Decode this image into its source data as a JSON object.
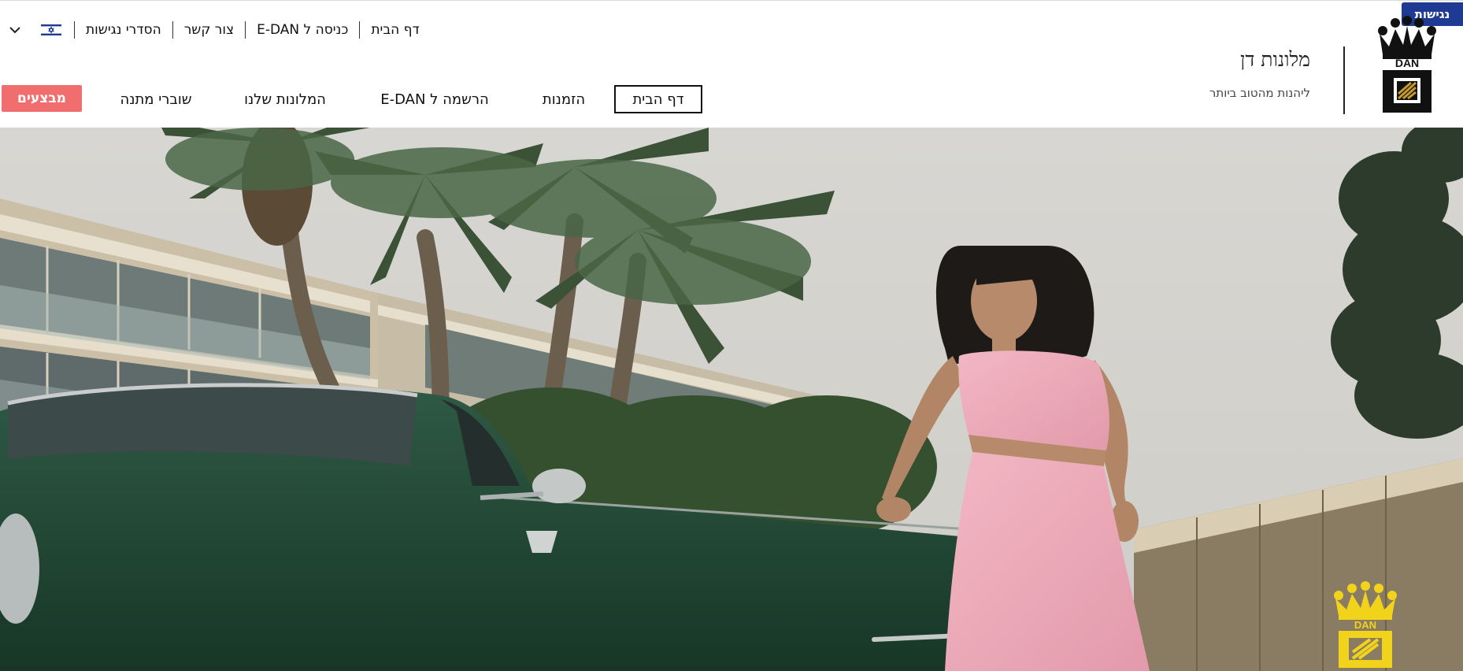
{
  "accessibility_tab": {
    "label": "נגישות"
  },
  "brand": {
    "title": "מלונות דן",
    "tagline": "ליהנות מהטוב ביותר",
    "logo_text": "DAN"
  },
  "utility_links": {
    "home": "דף הבית",
    "edan_login": "כניסה ל E-DAN",
    "contact": "צור קשר",
    "accessibility": "הסדרי נגישות"
  },
  "language": {
    "selected_icon": "israel-flag-icon",
    "dropdown_icon": "chevron-down-icon"
  },
  "main_nav": {
    "home": "דף הבית",
    "bookings": "הזמנות",
    "edan_register": "הרשמה ל E-DAN",
    "our_hotels": "המלונות שלנו",
    "gift_vouchers": "שוברי מתנה",
    "deals": "מבצעים"
  },
  "colors": {
    "accent_blue": "#1f3a93",
    "deals_coral": "#f06e6e",
    "logo_yellow": "#f2d31b",
    "logo_black": "#111111"
  },
  "hero": {
    "logo_text": "DAN"
  }
}
